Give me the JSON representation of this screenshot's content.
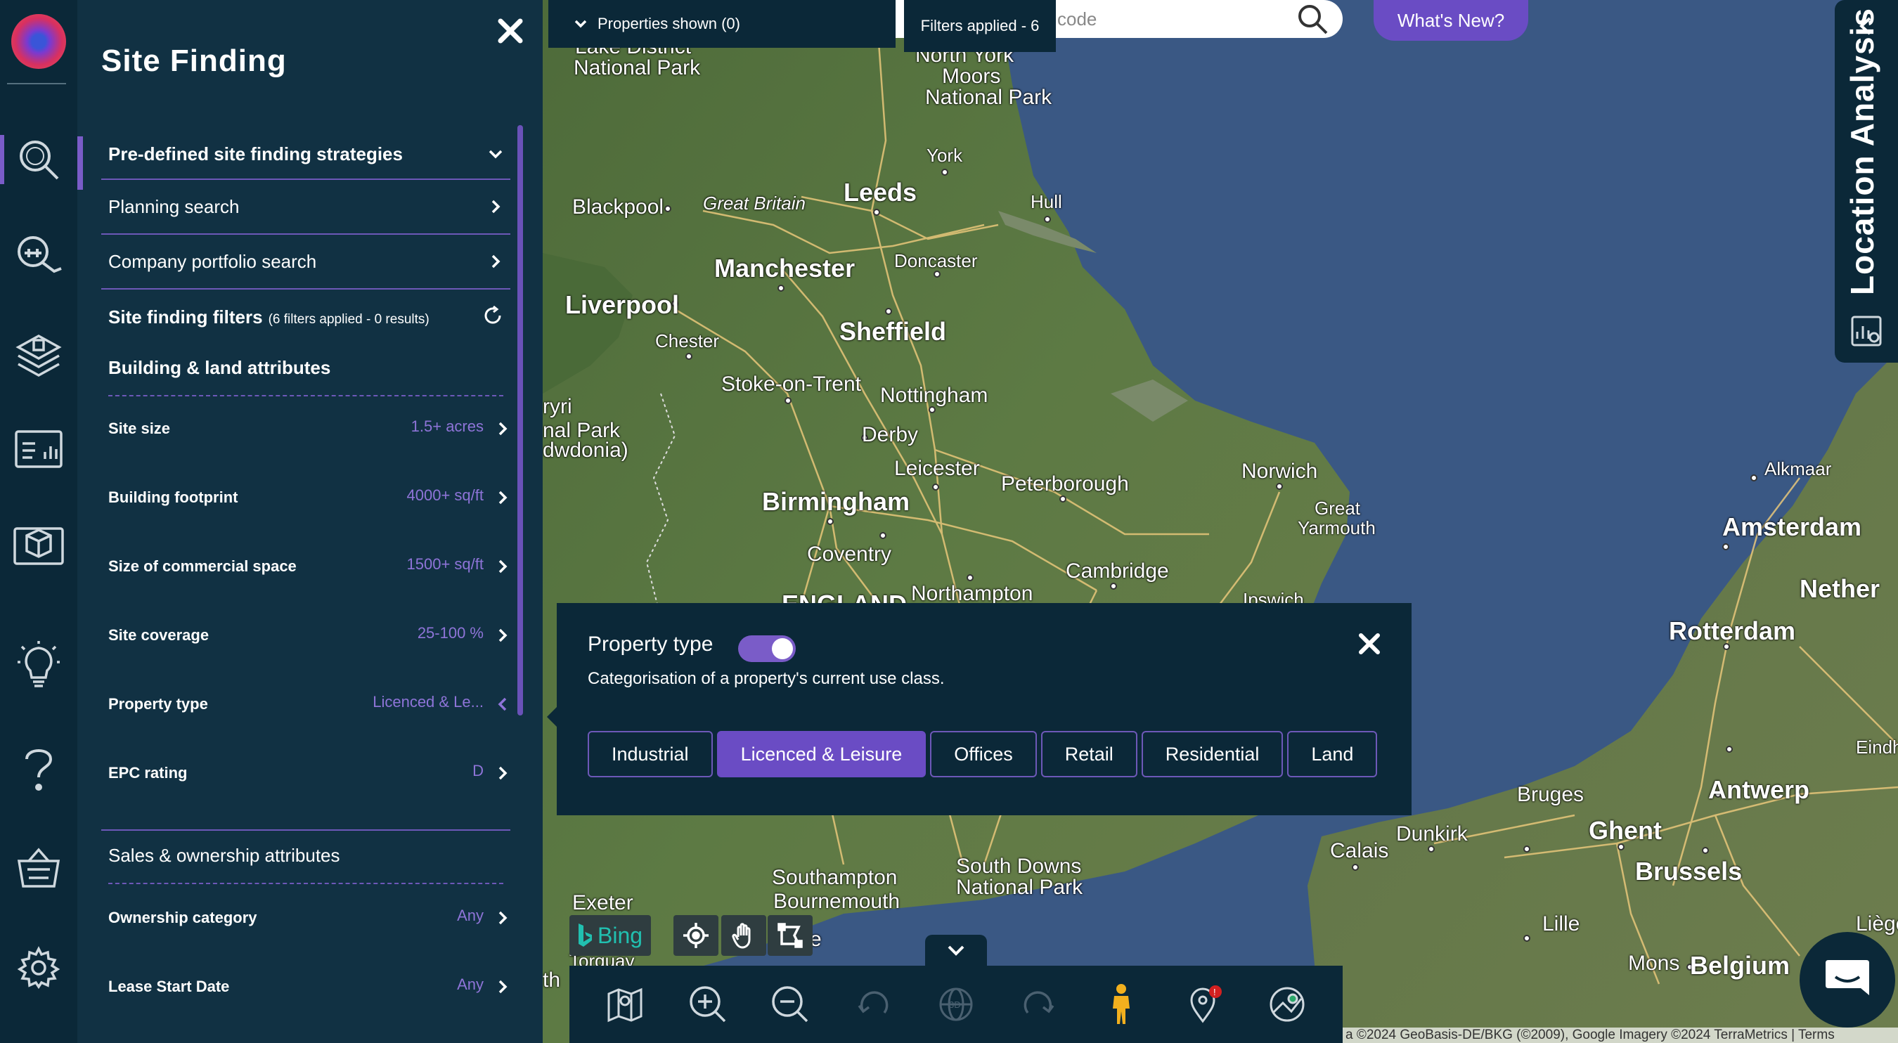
{
  "header": {
    "properties_shown": "Properties shown (0)",
    "filters_applied": "Filters applied - 6",
    "search_placeholder": "code",
    "whats_new": "What's New?"
  },
  "panel": {
    "title": "Site Finding",
    "accordions": [
      {
        "label": "Pre-defined site finding strategies"
      },
      {
        "label": "Planning search"
      },
      {
        "label": "Company portfolio search"
      }
    ],
    "filters_heading": "Site finding filters",
    "filters_note": "(6 filters applied - 0 results)",
    "building_section": "Building & land attributes",
    "building_filters": [
      {
        "label": "Site size",
        "value": "1.5+ acres"
      },
      {
        "label": "Building footprint",
        "value": "4000+ sq/ft"
      },
      {
        "label": "Size of commercial space",
        "value": "1500+ sq/ft"
      },
      {
        "label": "Site coverage",
        "value": "25-100 %"
      },
      {
        "label": "Property type",
        "value": "Licenced & Le..."
      },
      {
        "label": "EPC rating",
        "value": "D"
      }
    ],
    "sales_section": "Sales & ownership attributes",
    "sales_filters": [
      {
        "label": "Ownership category",
        "value": "Any"
      },
      {
        "label": "Lease Start Date",
        "value": "Any"
      }
    ]
  },
  "location_analysis": {
    "label": "Location Analysis"
  },
  "popup": {
    "title": "Property type",
    "toggle_on": true,
    "description": "Categorisation of a property's current use class.",
    "options": [
      "Industrial",
      "Licenced & Leisure",
      "Offices",
      "Retail",
      "Residential",
      "Land"
    ],
    "selected": "Licenced & Leisure"
  },
  "map": {
    "bing_label": "Bing",
    "attribution": "a ©2024 GeoBasis-DE/BKG (©2009), Google Imagery ©2024 TerraMetrics | Terms",
    "places": [
      {
        "name": "Lake District",
        "cls": "m"
      },
      {
        "name": "National Park",
        "cls": "m"
      },
      {
        "name": "North York",
        "cls": "m"
      },
      {
        "name": "Moors",
        "cls": "m"
      },
      {
        "name": "National Park",
        "cls": "m"
      },
      {
        "name": "York",
        "cls": "s"
      },
      {
        "name": "Leeds",
        "cls": "l"
      },
      {
        "name": "Great Britain",
        "cls": "it"
      },
      {
        "name": "Blackpool",
        "cls": "m"
      },
      {
        "name": "Hull",
        "cls": "s"
      },
      {
        "name": "Manchester",
        "cls": "l"
      },
      {
        "name": "Doncaster",
        "cls": "s"
      },
      {
        "name": "Liverpool",
        "cls": "l"
      },
      {
        "name": "Sheffield",
        "cls": "l"
      },
      {
        "name": "Chester",
        "cls": "s"
      },
      {
        "name": "Stoke-on-Trent",
        "cls": "m"
      },
      {
        "name": "Nottingham",
        "cls": "m"
      },
      {
        "name": "Derby",
        "cls": "m"
      },
      {
        "name": "ryri",
        "cls": "m"
      },
      {
        "name": "nal Park",
        "cls": "m"
      },
      {
        "name": "dwdonia)",
        "cls": "m"
      },
      {
        "name": "Leicester",
        "cls": "m"
      },
      {
        "name": "Peterborough",
        "cls": "m"
      },
      {
        "name": "Norwich",
        "cls": "m"
      },
      {
        "name": "Great",
        "cls": "s"
      },
      {
        "name": "Yarmouth",
        "cls": "s"
      },
      {
        "name": "Birmingham",
        "cls": "l"
      },
      {
        "name": "Coventry",
        "cls": "m"
      },
      {
        "name": "Cambridge",
        "cls": "m"
      },
      {
        "name": "Northampton",
        "cls": "m"
      },
      {
        "name": "ENGLAND",
        "cls": "l"
      },
      {
        "name": "Ipswich",
        "cls": "s"
      },
      {
        "name": "Alkmaar",
        "cls": "s"
      },
      {
        "name": "Amsterdam",
        "cls": "l"
      },
      {
        "name": "Nether",
        "cls": "l"
      },
      {
        "name": "Rotterdam",
        "cls": "l"
      },
      {
        "name": "Eindhove",
        "cls": "s"
      },
      {
        "name": "Bruges",
        "cls": "m"
      },
      {
        "name": "Antwerp",
        "cls": "l"
      },
      {
        "name": "Ghent",
        "cls": "l"
      },
      {
        "name": "Dunkirk",
        "cls": "m"
      },
      {
        "name": "Calais",
        "cls": "m"
      },
      {
        "name": "Brussels",
        "cls": "l"
      },
      {
        "name": "Lille",
        "cls": "m"
      },
      {
        "name": "Mons",
        "cls": "m"
      },
      {
        "name": "Liège",
        "cls": "m"
      },
      {
        "name": "Belgium",
        "cls": "l"
      },
      {
        "name": "Southampton",
        "cls": "m"
      },
      {
        "name": "Bournemouth",
        "cls": "m"
      },
      {
        "name": "South Downs",
        "cls": "m"
      },
      {
        "name": "National Park",
        "cls": "m"
      },
      {
        "name": "Exeter",
        "cls": "m"
      },
      {
        "name": "Torquay",
        "cls": "s"
      },
      {
        "name": "oole",
        "cls": "m"
      },
      {
        "name": "th",
        "cls": "m"
      }
    ]
  },
  "colors": {
    "panel_bg": "#113143",
    "dark_bg": "#0b2838",
    "accent": "#6a4cc4",
    "accent_text": "#8e74d8"
  }
}
